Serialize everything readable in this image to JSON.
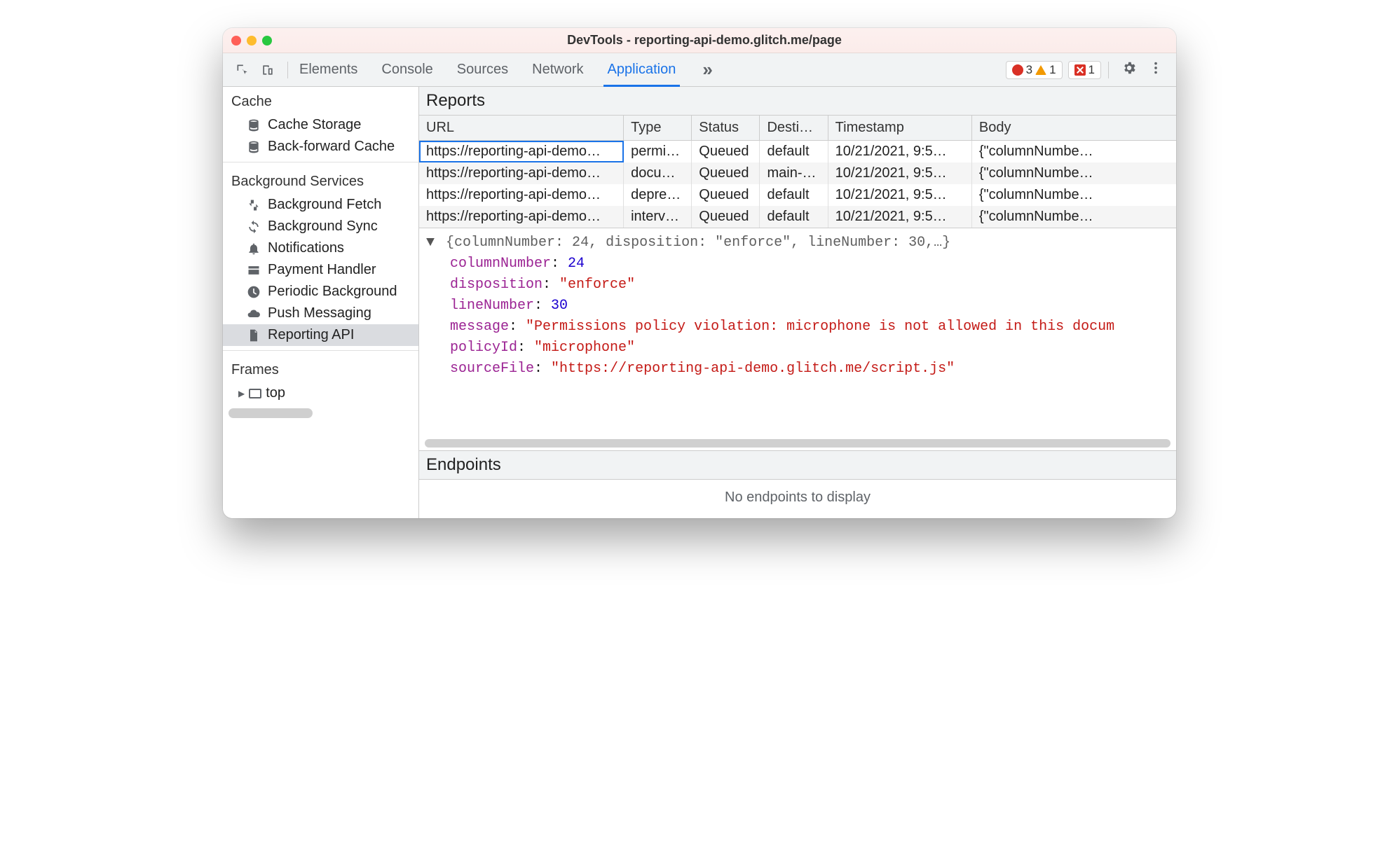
{
  "window": {
    "title": "DevTools - reporting-api-demo.glitch.me/page"
  },
  "toolbar": {
    "tabs": [
      "Elements",
      "Console",
      "Sources",
      "Network",
      "Application"
    ],
    "active_tab_index": 4,
    "errors": "3",
    "warnings": "1",
    "critical": "1"
  },
  "sidebar": {
    "sections": [
      {
        "title": "Cache",
        "items": [
          {
            "label": "Cache Storage",
            "icon": "database-icon"
          },
          {
            "label": "Back-forward Cache",
            "icon": "database-icon"
          }
        ]
      },
      {
        "title": "Background Services",
        "items": [
          {
            "label": "Background Fetch",
            "icon": "fetch-icon"
          },
          {
            "label": "Background Sync",
            "icon": "sync-icon"
          },
          {
            "label": "Notifications",
            "icon": "bell-icon"
          },
          {
            "label": "Payment Handler",
            "icon": "card-icon"
          },
          {
            "label": "Periodic Background",
            "icon": "clock-icon"
          },
          {
            "label": "Push Messaging",
            "icon": "cloud-icon"
          },
          {
            "label": "Reporting API",
            "icon": "file-icon",
            "selected": true
          }
        ]
      },
      {
        "title": "Frames",
        "frames": [
          {
            "label": "top"
          }
        ]
      }
    ]
  },
  "reports": {
    "title": "Reports",
    "headers": [
      "URL",
      "Type",
      "Status",
      "Desti…",
      "Timestamp",
      "Body"
    ],
    "rows": [
      {
        "url": "https://reporting-api-demo…",
        "type": "permi…",
        "status": "Queued",
        "dest": "default",
        "ts": "10/21/2021, 9:5…",
        "body": "{\"columnNumbe…",
        "selected": true
      },
      {
        "url": "https://reporting-api-demo…",
        "type": "docu…",
        "status": "Queued",
        "dest": "main-…",
        "ts": "10/21/2021, 9:5…",
        "body": "{\"columnNumbe…"
      },
      {
        "url": "https://reporting-api-demo…",
        "type": "depre…",
        "status": "Queued",
        "dest": "default",
        "ts": "10/21/2021, 9:5…",
        "body": "{\"columnNumbe…"
      },
      {
        "url": "https://reporting-api-demo…",
        "type": "interv…",
        "status": "Queued",
        "dest": "default",
        "ts": "10/21/2021, 9:5…",
        "body": "{\"columnNumbe…"
      }
    ]
  },
  "detail": {
    "summary": "{columnNumber: 24, disposition: \"enforce\", lineNumber: 30,…}",
    "props": {
      "columnNumber": 24,
      "disposition": "\"enforce\"",
      "lineNumber": 30,
      "message": "\"Permissions policy violation: microphone is not allowed in this docum",
      "policyId": "\"microphone\"",
      "sourceFile": "\"https://reporting-api-demo.glitch.me/script.js\""
    }
  },
  "endpoints": {
    "title": "Endpoints",
    "empty": "No endpoints to display"
  }
}
